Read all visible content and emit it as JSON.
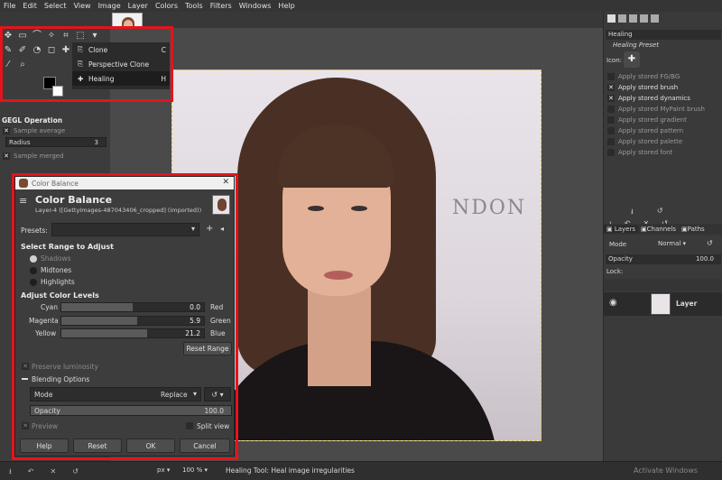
{
  "menu": [
    "File",
    "Edit",
    "Select",
    "View",
    "Image",
    "Layer",
    "Colors",
    "Tools",
    "Filters",
    "Windows",
    "Help"
  ],
  "tool_popup": {
    "items": [
      {
        "label": "Clone",
        "shortcut": "C"
      },
      {
        "label": "Perspective Clone",
        "shortcut": ""
      },
      {
        "label": "Healing",
        "shortcut": "H"
      }
    ]
  },
  "tool_options": {
    "gegl_title": "GEGL Operation",
    "sample_average": "Sample average",
    "radius_label": "Radius",
    "radius_value": "3",
    "sample_merged": "Sample merged"
  },
  "right_panel": {
    "tool_name": "Healing",
    "preset_label": "Healing Preset",
    "icon_label": "Icon:",
    "options": [
      {
        "label": "Apply stored FG/BG",
        "checked": false
      },
      {
        "label": "Apply stored brush",
        "checked": true
      },
      {
        "label": "Apply stored dynamics",
        "checked": true
      },
      {
        "label": "Apply stored MyPaint brush",
        "checked": false
      },
      {
        "label": "Apply stored gradient",
        "checked": false
      },
      {
        "label": "Apply stored pattern",
        "checked": false
      },
      {
        "label": "Apply stored palette",
        "checked": false
      },
      {
        "label": "Apply stored font",
        "checked": false
      }
    ],
    "tabs": [
      "Layers",
      "Channels",
      "Paths"
    ],
    "mode_label": "Mode",
    "mode_value": "Normal",
    "opacity_label": "Opacity",
    "opacity_value": "100.0",
    "lock_label": "Lock:",
    "layer_name": "Layer"
  },
  "dialog": {
    "window_title": "Color Balance",
    "heading": "Color Balance",
    "subtitle": "Layer-4 ([GettyImages-487043406_cropped] (imported))",
    "presets_label": "Presets:",
    "range_heading": "Select Range to Adjust",
    "ranges": [
      {
        "label": "Shadows",
        "selected": true
      },
      {
        "label": "Midtones",
        "selected": false
      },
      {
        "label": "Highlights",
        "selected": false
      }
    ],
    "levels_heading": "Adjust Color Levels",
    "levels": [
      {
        "left": "Cyan",
        "right": "Red",
        "value": "0.0",
        "fill": 0.5
      },
      {
        "left": "Magenta",
        "right": "Green",
        "value": "5.9",
        "fill": 0.53
      },
      {
        "left": "Yellow",
        "right": "Blue",
        "value": "21.2",
        "fill": 0.6
      }
    ],
    "reset_range": "Reset Range",
    "preserve_luminosity": "Preserve luminosity",
    "blending_options": "Blending Options",
    "mode_label": "Mode",
    "mode_value": "Replace",
    "opacity_label": "Opacity",
    "opacity_value": "100.0",
    "preview": "Preview",
    "split_view": "Split view",
    "buttons": {
      "help": "Help",
      "reset": "Reset",
      "ok": "OK",
      "cancel": "Cancel"
    }
  },
  "image_text": "NDON",
  "status": {
    "unit": "px",
    "zoom": "100 %",
    "message": "Healing Tool: Heal image irregularities",
    "watermark": "Activate Windows"
  },
  "colors": {
    "highlight": "#e3141c"
  }
}
